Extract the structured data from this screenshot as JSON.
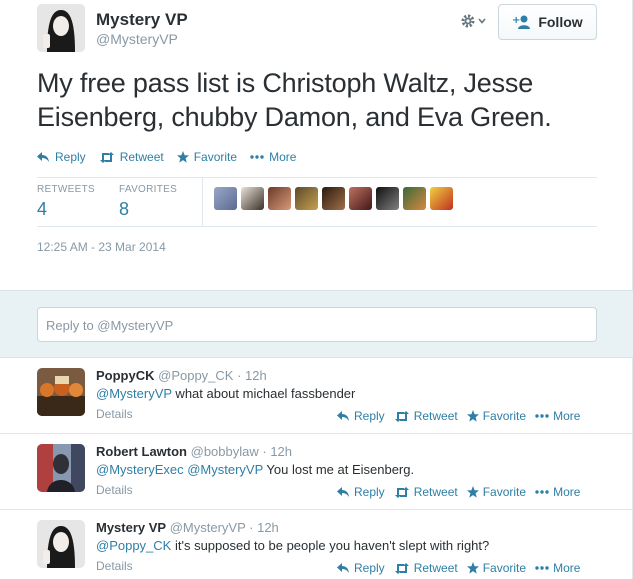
{
  "tweet": {
    "name": "Mystery VP",
    "handle": "@MysteryVP",
    "text": "My free pass list is Christoph Waltz, Jesse Eisenberg, chubby Damon, and Eva Green.",
    "follow_label": "Follow",
    "settings_icon": "gear-icon",
    "actions": {
      "reply": "Reply",
      "retweet": "Retweet",
      "favorite": "Favorite",
      "more": "More"
    },
    "stats": {
      "retweets_label": "RETWEETS",
      "retweets_value": "4",
      "favorites_label": "FAVORITES",
      "favorites_value": "8"
    },
    "favoriters_count": 10,
    "timestamp": "12:25 AM - 23 Mar 2014"
  },
  "reply_box": {
    "placeholder": "Reply to @MysteryVP"
  },
  "replies": [
    {
      "name": "PoppyCK",
      "handle": "@Poppy_CK",
      "time": "· 12h",
      "mentions": [
        "@MysteryVP"
      ],
      "text": " what about michael fassbender",
      "details": "Details",
      "actions": {
        "reply": "Reply",
        "retweet": "Retweet",
        "favorite": "Favorite",
        "more": "More"
      }
    },
    {
      "name": "Robert Lawton",
      "handle": "@bobbylaw",
      "time": "· 12h",
      "mentions": [
        "@MysteryExec",
        "@MysteryVP"
      ],
      "text": " You lost me at Eisenberg.",
      "details": "Details",
      "actions": {
        "reply": "Reply",
        "retweet": "Retweet",
        "favorite": "Favorite",
        "more": "More"
      }
    },
    {
      "name": "Mystery VP",
      "handle": "@MysteryVP",
      "time": "· 12h",
      "mentions": [
        "@Poppy_CK"
      ],
      "text": " it's supposed to be people you haven't slept with right?",
      "details": "Details",
      "actions": {
        "reply": "Reply",
        "retweet": "Retweet",
        "favorite": "Favorite",
        "more": "More"
      }
    }
  ],
  "colors": {
    "link": "#2e7fa6",
    "muted": "#8899a6",
    "reply_bg": "#e8f2f4"
  }
}
